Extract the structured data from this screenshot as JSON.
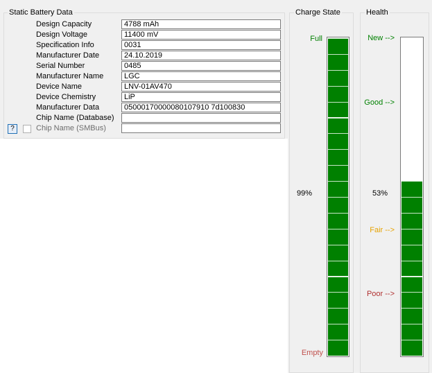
{
  "static": {
    "title": "Static Battery Data",
    "rows": [
      {
        "label": "Design Capacity",
        "value": "4788 mAh"
      },
      {
        "label": "Design Voltage",
        "value": "11400 mV"
      },
      {
        "label": "Specification Info",
        "value": "0031"
      },
      {
        "label": "Manufacturer Date",
        "value": "24.10.2019"
      },
      {
        "label": "Serial Number",
        "value": "0485"
      },
      {
        "label": "Manufacturer Name",
        "value": "LGC"
      },
      {
        "label": "Device Name",
        "value": "LNV-01AV470"
      },
      {
        "label": "Device Chemistry",
        "value": "LiP"
      },
      {
        "label": "Manufacturer Data",
        "value": "05000170000080107910 7d100830"
      },
      {
        "label": "Chip Name (Database)",
        "value": ""
      },
      {
        "label": "Chip Name (SMBus)",
        "value": ""
      }
    ],
    "help_label": "?"
  },
  "charge": {
    "title": "Charge State",
    "full_label": "Full",
    "empty_label": "Empty",
    "percent_label": "99%",
    "level": 0.99
  },
  "health": {
    "title": "Health",
    "new_label": "New -->",
    "good_label": "Good -->",
    "fair_label": "Fair -->",
    "poor_label": "Poor -->",
    "percent_label": "53%",
    "level": 0.53
  },
  "colors": {
    "bar_fill": "#008000",
    "full": "#008000",
    "empty": "#c0504d",
    "new": "#008000",
    "good": "#008000",
    "fair": "#e6a200",
    "poor": "#b03030"
  }
}
